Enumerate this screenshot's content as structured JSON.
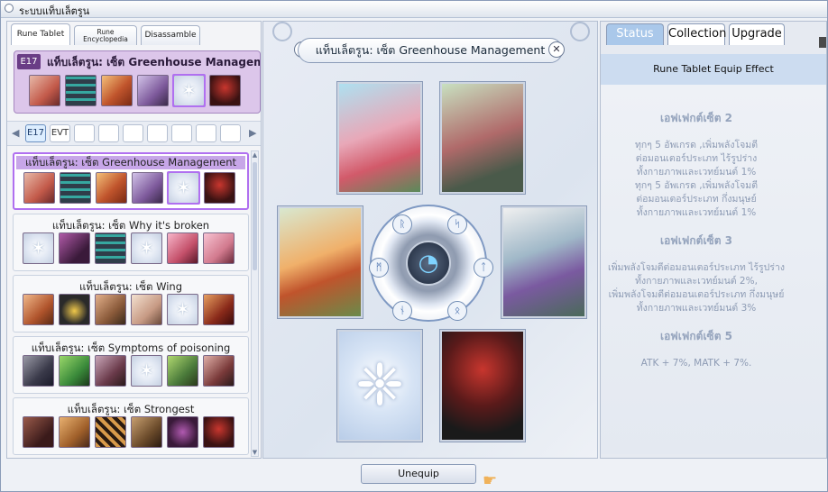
{
  "window": {
    "title": "ระบบแท็บเล็ตรูน"
  },
  "left_tabs": [
    {
      "label": "Rune Tablet"
    },
    {
      "label": "Rune Encyclopedia"
    },
    {
      "label": "Disassamble"
    }
  ],
  "featured": {
    "badge": "E17",
    "title": "แท็บเล็ตรูน: เซ็ต Greenhouse Management"
  },
  "pager": {
    "items": [
      "E17",
      "EVT",
      "",
      "",
      "",
      "",
      "",
      "",
      ""
    ]
  },
  "sets": [
    {
      "title": "แท็บเล็ตรูน: เซ็ต Greenhouse Management",
      "selected": true
    },
    {
      "title": "แท็บเล็ตรูน: เซ็ต Why it's broken",
      "selected": false
    },
    {
      "title": "แท็บเล็ตรูน: เซ็ต Wing",
      "selected": false
    },
    {
      "title": "แท็บเล็ตรูน: เซ็ต Symptoms of poisoning",
      "selected": false
    },
    {
      "title": "แท็บเล็ตรูน: เซ็ต Strongest",
      "selected": false
    }
  ],
  "banner": "แท็บเล็ตรูน: เซ็ต Greenhouse Management",
  "right_tabs": [
    "Status",
    "Collection",
    "Upgrade"
  ],
  "rune_effect_header": "Rune Tablet Equip Effect",
  "effects": [
    {
      "header": "เอฟเฟกต์เซ็ต 2",
      "lines": [
        "ทุกๆ 5 อัพเกรด ,เพิ่มพลังโจมตี",
        "ต่อมอนเตอร์ประเภท ไร้รูปร่าง",
        "ทั้งกายภาพและเวทย์มนต์ 1%",
        "ทุกๆ 5 อัพเกรด ,เพิ่มพลังโจมตี",
        "ต่อมอนเตอร์ประเภท กึ่งมนุษย์",
        "ทั้งกายภาพและเวทย์มนต์ 1%"
      ]
    },
    {
      "header": "เอฟเฟกต์เซ็ต 3",
      "lines": [
        "เพิ่มพลังโจมตีต่อมอนเตอร์ประเภท ไร้รูปร่าง",
        "ทั้งกายภาพและเวทย์มนต์ 2%,",
        "เพิ่มพลังโจมตีต่อมอนเตอร์ประเภท กึ่งมนุษย์",
        "ทั้งกายภาพและเวทย์มนต์ 3%"
      ]
    },
    {
      "header": "เอฟเฟกต์เซ็ต 5",
      "lines": [
        "ATK + 7%, MATK + 7%."
      ]
    }
  ],
  "footer": {
    "unequip_label": "Unequip"
  },
  "colors": {
    "accent": "#b070f0",
    "badge": "#6a3d86",
    "tab_active": "#aac8ea",
    "effect_text": "#8d9bb4"
  }
}
